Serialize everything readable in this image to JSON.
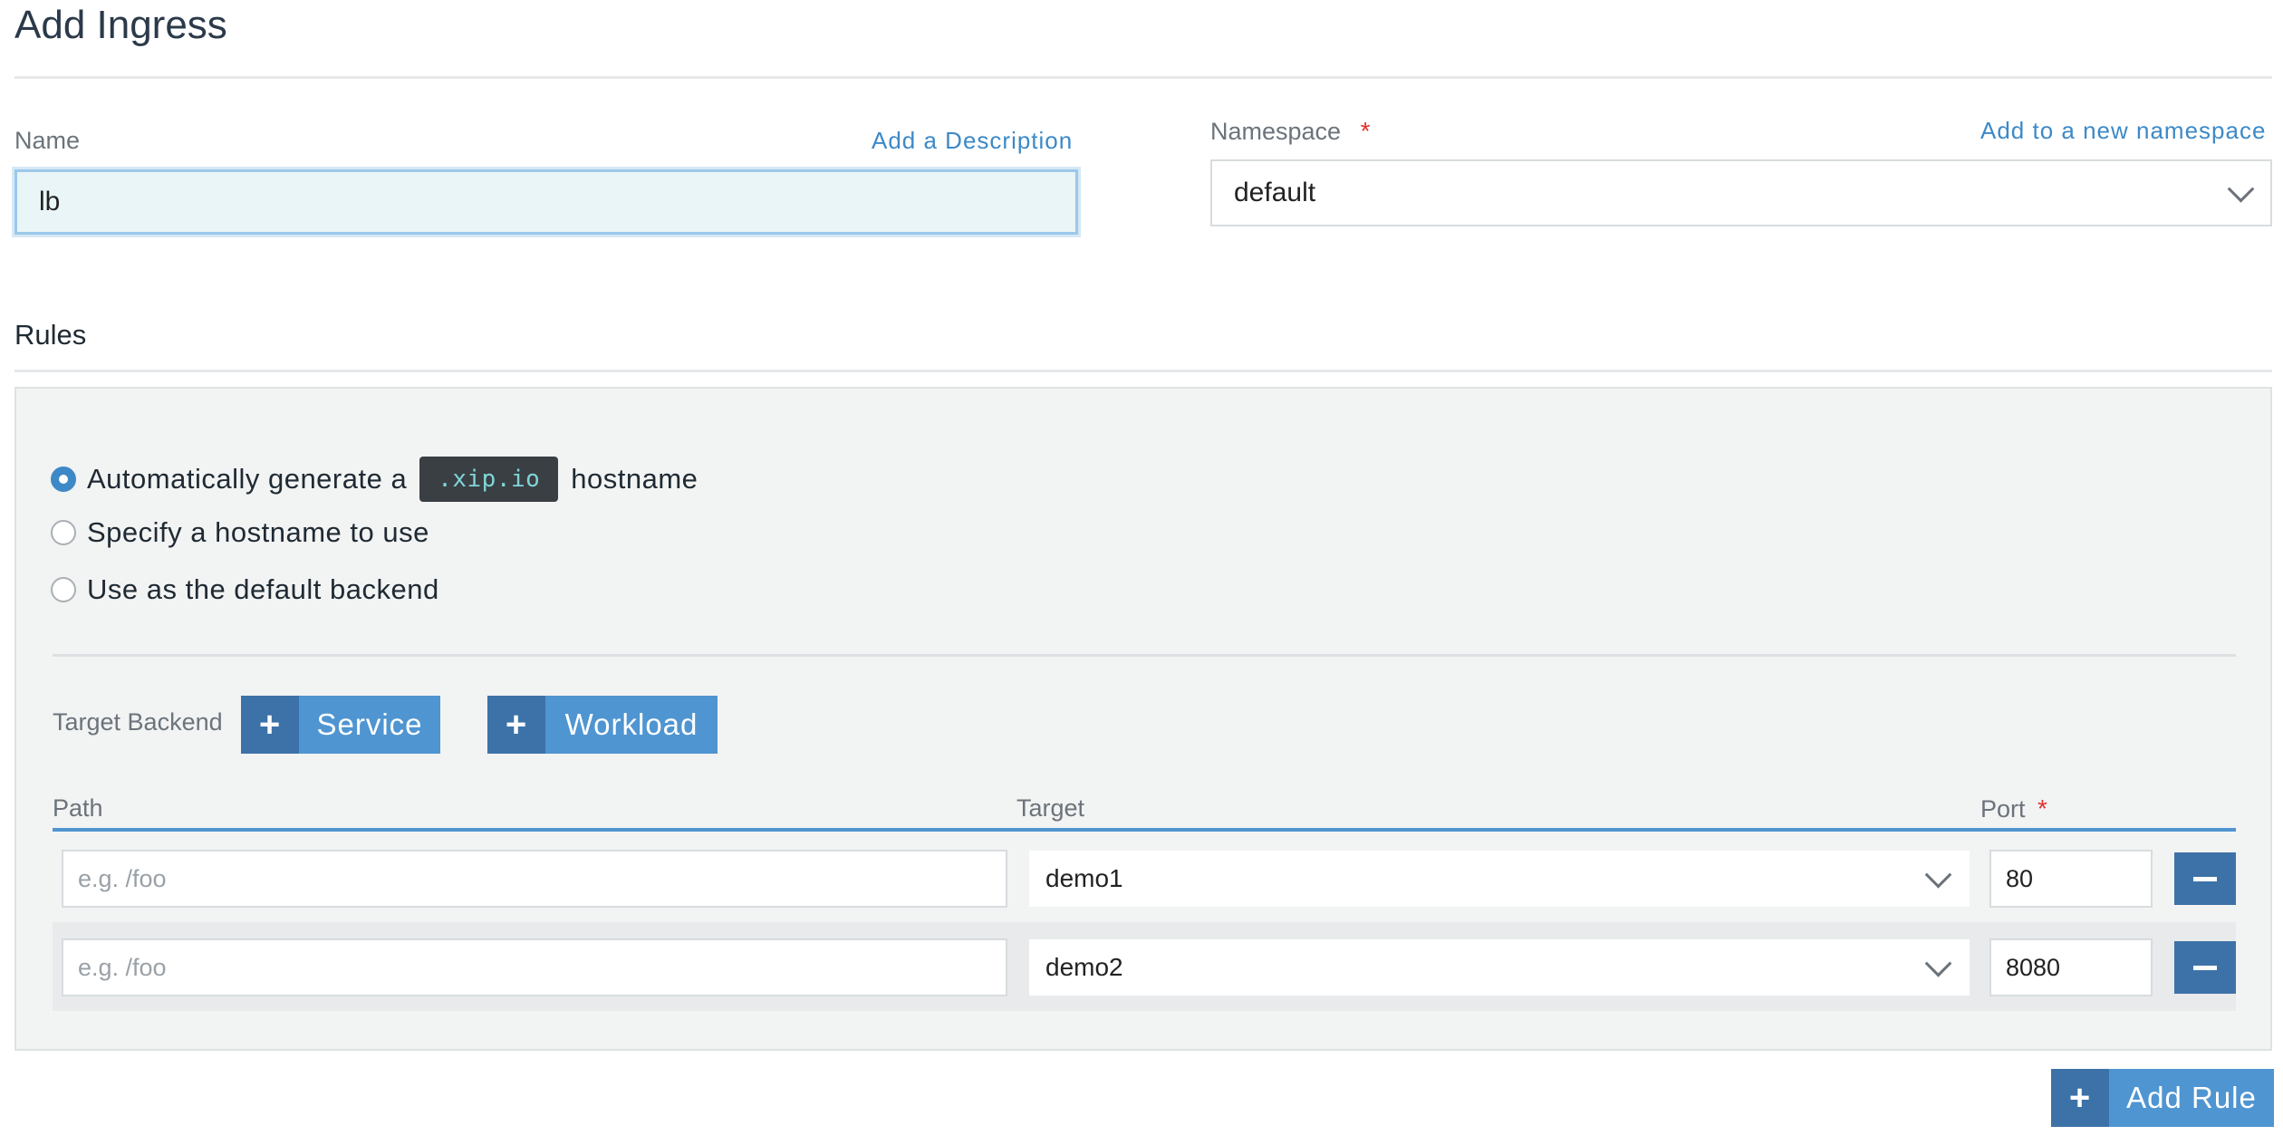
{
  "page": {
    "title": "Add Ingress"
  },
  "name_field": {
    "label": "Name",
    "value": "lb",
    "add_description": "Add a Description"
  },
  "namespace_field": {
    "label": "Namespace",
    "required_mark": "*",
    "selected": "default",
    "add_new": "Add to a new namespace"
  },
  "rules": {
    "label": "Rules",
    "host_options": [
      {
        "before": "Automatically generate a",
        "code": ".xip.io",
        "after": "hostname",
        "selected": true
      },
      {
        "label": "Specify a hostname to use",
        "selected": false
      },
      {
        "label": "Use as the default backend",
        "selected": false
      }
    ],
    "target_backend_label": "Target Backend",
    "service_button": "Service",
    "workload_button": "Workload",
    "columns": {
      "path": "Path",
      "target": "Target",
      "port": "Port",
      "port_required": "*"
    },
    "rows": [
      {
        "path_placeholder": "e.g. /foo",
        "target": "demo1",
        "port": "80"
      },
      {
        "path_placeholder": "e.g. /foo",
        "target": "demo2",
        "port": "8080"
      }
    ],
    "add_rule_button": "Add Rule"
  },
  "icons": {
    "plus": "plus-icon",
    "minus": "minus-icon",
    "chevron": "chevron-down-icon"
  },
  "colors": {
    "accent": "#4f95d1",
    "accent_dark": "#3d72a8",
    "link": "#3d89c7",
    "required": "#e0312c"
  }
}
